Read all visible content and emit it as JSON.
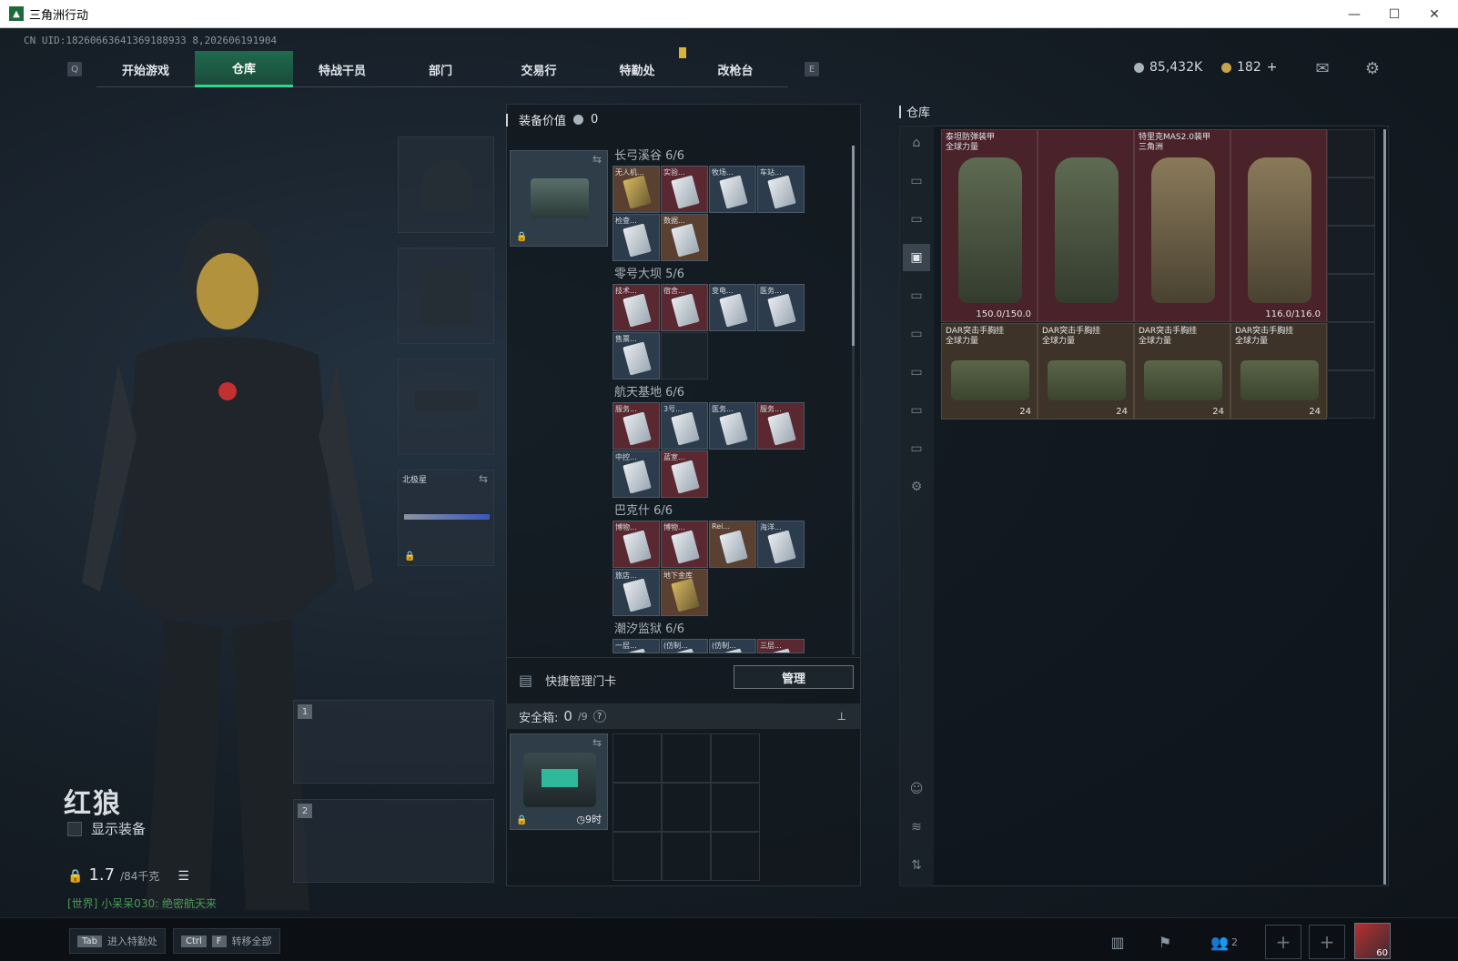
{
  "window": {
    "title": "三角洲行动"
  },
  "uid": "CN UID:18260663641369188933 8,202606191904",
  "nav": {
    "left_key": "Q",
    "right_key": "E",
    "tabs": [
      "开始游戏",
      "仓库",
      "特战干员",
      "部门",
      "交易行",
      "特勤处",
      "改枪台"
    ],
    "active": "仓库"
  },
  "currency": {
    "silver": "85,432K",
    "gold": "182",
    "gold_plus": "+"
  },
  "character": {
    "name": "红狼",
    "show_equipment": "显示装备",
    "weight": "1.7",
    "weight_max": "/84千克",
    "chat": "[世界] 小呆呆030: 绝密航天来"
  },
  "slots": {
    "backpack_label": "北极星",
    "weapon1_num": "1",
    "weapon2_num": "2"
  },
  "equip_value": {
    "label": "装备价值",
    "value": "0"
  },
  "maps": [
    {
      "name": "长弓溪谷",
      "count": "6/6",
      "cards": [
        {
          "label": "无人机...",
          "color": "orange",
          "gold": true
        },
        {
          "label": "实验...",
          "color": "red"
        },
        {
          "label": "牧场...",
          "color": "blue"
        },
        {
          "label": "车站...",
          "color": "blue"
        },
        {
          "label": "检查...",
          "color": "blue"
        },
        {
          "label": "数据...",
          "color": "orange"
        }
      ]
    },
    {
      "name": "零号大坝",
      "count": "5/6",
      "cards": [
        {
          "label": "技术...",
          "color": "red"
        },
        {
          "label": "宿舍...",
          "color": "red"
        },
        {
          "label": "变电...",
          "color": "blue"
        },
        {
          "label": "医务...",
          "color": "blue"
        },
        {
          "label": "售票...",
          "color": "blue"
        }
      ]
    },
    {
      "name": "航天基地",
      "count": "6/6",
      "cards": [
        {
          "label": "服务...",
          "color": "red"
        },
        {
          "label": "3号...",
          "color": "blue"
        },
        {
          "label": "医务...",
          "color": "blue"
        },
        {
          "label": "服务...",
          "color": "red"
        },
        {
          "label": "中控...",
          "color": "blue"
        },
        {
          "label": "蓝室...",
          "color": "red"
        }
      ]
    },
    {
      "name": "巴克什",
      "count": "6/6",
      "cards": [
        {
          "label": "博物...",
          "color": "red"
        },
        {
          "label": "博物...",
          "color": "red"
        },
        {
          "label": "Rei...",
          "color": "orange"
        },
        {
          "label": "海洋...",
          "color": "blue"
        },
        {
          "label": "旅店...",
          "color": "blue"
        },
        {
          "label": "地下金库",
          "color": "orange",
          "gold": true
        }
      ]
    },
    {
      "name": "潮汐监狱",
      "count": "6/6",
      "cards": [
        {
          "label": "一层...",
          "color": "blue"
        },
        {
          "label": "(仿制...",
          "color": "blue"
        },
        {
          "label": "(仿制...",
          "color": "blue"
        },
        {
          "label": "三层...",
          "color": "red"
        }
      ]
    }
  ],
  "quick_manage": {
    "label": "快捷管理门卡",
    "button": "管理"
  },
  "safebox": {
    "label": "安全箱:",
    "count": "0",
    "capacity": "/9",
    "help": "?",
    "timer": "9时"
  },
  "warehouse": {
    "title": "仓库",
    "armors": [
      {
        "name": "泰坦防弹装甲",
        "brand": "全球力量",
        "durability": "150.0/150.0"
      },
      {
        "name": "特里克MAS2.0装甲",
        "brand": "三角洲",
        "durability": "116.0/116.0"
      }
    ],
    "rigs": [
      {
        "name": "DAR突击手胸挂",
        "brand": "全球力量",
        "count": "24"
      },
      {
        "name": "DAR突击手胸挂",
        "brand": "全球力量",
        "count": "24"
      },
      {
        "name": "DAR突击手胸挂",
        "brand": "全球力量",
        "count": "24"
      },
      {
        "name": "DAR突击手胸挂",
        "brand": "全球力量",
        "count": "24"
      }
    ]
  },
  "bottom": {
    "hint1_key": "Tab",
    "hint1": "进入特勤处",
    "hint2_key1": "Ctrl",
    "hint2_key2": "F",
    "hint2": "转移全部",
    "friends": "2",
    "avatar_level": "60"
  },
  "colors": {
    "accent": "#2fd98a",
    "red_slot": "#4a2229",
    "blue_slot": "#2c3c4c",
    "brown_slot": "#3e3328"
  }
}
